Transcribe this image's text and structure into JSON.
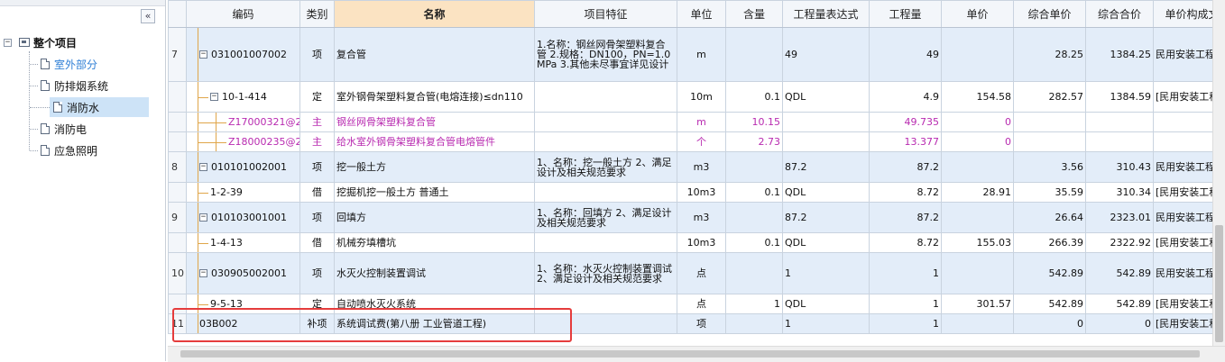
{
  "sidebar": {
    "collapse_label": "«",
    "root": {
      "toggle": "−",
      "label": "整个项目"
    },
    "items": [
      {
        "label": "室外部分",
        "selected": false,
        "link": true
      },
      {
        "label": "防排烟系统",
        "selected": false,
        "link": false
      },
      {
        "label": "消防水",
        "selected": true,
        "link": false
      },
      {
        "label": "消防电",
        "selected": false,
        "link": false
      },
      {
        "label": "应急照明",
        "selected": false,
        "link": false
      }
    ]
  },
  "table": {
    "headers": {
      "code": "编码",
      "category": "类别",
      "name": "名称",
      "feature": "项目特征",
      "unit": "单位",
      "content": "含量",
      "expr_header": "工程量表达式",
      "quantity": "工程量",
      "unit_price": "单价",
      "comp_unit_price": "综合单价",
      "comp_total": "综合合价",
      "price_struct": "单价构成文"
    },
    "rows": [
      {
        "no": "7",
        "level": 0,
        "toggle": "−",
        "code": "031001007002",
        "category": "项",
        "name": "复合管",
        "feature": "1.名称：钢丝网骨架塑料复合管\n2.规格：DN100，PN=1.0MPa\n3.其他未尽事宜详见设计",
        "unit": "m",
        "content": "",
        "expr": "49",
        "quantity": "49",
        "unit_price": "",
        "comp_unit_price": "28.25",
        "comp_total": "1384.25",
        "price_struct": "民用安装工程"
      },
      {
        "no": "",
        "level": 1,
        "toggle": "−",
        "code": "10-1-414",
        "category": "定",
        "name": "室外钢骨架塑料复合管(电熔连接)≤dn110",
        "feature": "",
        "unit": "10m",
        "content": "0.1",
        "expr": "QDL",
        "quantity": "4.9",
        "unit_price": "154.58",
        "comp_unit_price": "282.57",
        "comp_total": "1384.59",
        "price_struct": "[民用安装工程"
      },
      {
        "no": "",
        "level": 2,
        "toggle": "",
        "code": "Z17000321@2",
        "category": "主",
        "name": "钢丝网骨架塑料复合管",
        "feature": "",
        "unit": "m",
        "content": "10.15",
        "expr": "",
        "quantity": "49.735",
        "unit_price": "0",
        "comp_unit_price": "",
        "comp_total": "",
        "price_struct": ""
      },
      {
        "no": "",
        "level": 2,
        "toggle": "",
        "code": "Z18000235@2",
        "category": "主",
        "name": "给水室外钢骨架塑料复合管电熔管件",
        "feature": "",
        "unit": "个",
        "content": "2.73",
        "expr": "",
        "quantity": "13.377",
        "unit_price": "0",
        "comp_unit_price": "",
        "comp_total": "",
        "price_struct": ""
      },
      {
        "no": "8",
        "level": 0,
        "toggle": "−",
        "code": "010101002001",
        "category": "项",
        "name": "挖一般土方",
        "feature": "1、名称：挖一般土方\n2、满足设计及相关规范要求",
        "unit": "m3",
        "content": "",
        "expr": "87.2",
        "quantity": "87.2",
        "unit_price": "",
        "comp_unit_price": "3.56",
        "comp_total": "310.43",
        "price_struct": "民用安装工程"
      },
      {
        "no": "",
        "level": 1,
        "toggle": "",
        "code": "1-2-39",
        "category": "借",
        "name": "挖掘机挖一般土方 普通土",
        "feature": "",
        "unit": "10m3",
        "content": "0.1",
        "expr": "QDL",
        "quantity": "8.72",
        "unit_price": "28.91",
        "comp_unit_price": "35.59",
        "comp_total": "310.34",
        "price_struct": "[民用安装工程"
      },
      {
        "no": "9",
        "level": 0,
        "toggle": "−",
        "code": "010103001001",
        "category": "项",
        "name": "回填方",
        "feature": "1、名称：回填方\n2、满足设计及相关规范要求",
        "unit": "m3",
        "content": "",
        "expr": "87.2",
        "quantity": "87.2",
        "unit_price": "",
        "comp_unit_price": "26.64",
        "comp_total": "2323.01",
        "price_struct": "民用安装工程"
      },
      {
        "no": "",
        "level": 1,
        "toggle": "",
        "code": "1-4-13",
        "category": "借",
        "name": "机械夯填槽坑",
        "feature": "",
        "unit": "10m3",
        "content": "0.1",
        "expr": "QDL",
        "quantity": "8.72",
        "unit_price": "155.03",
        "comp_unit_price": "266.39",
        "comp_total": "2322.92",
        "price_struct": "[民用安装工程"
      },
      {
        "no": "10",
        "level": 0,
        "toggle": "−",
        "code": "030905002001",
        "category": "项",
        "name": "水灭火控制装置调试",
        "feature": "1、名称：水灭火控制装置调试\n2、满足设计及相关规范要求",
        "unit": "点",
        "content": "",
        "expr": "1",
        "quantity": "1",
        "unit_price": "",
        "comp_unit_price": "542.89",
        "comp_total": "542.89",
        "price_struct": "民用安装工程"
      },
      {
        "no": "",
        "level": 1,
        "toggle": "",
        "code": "9-5-13",
        "category": "定",
        "name": "自动喷水灭火系统",
        "feature": "",
        "unit": "点",
        "content": "1",
        "expr": "QDL",
        "quantity": "1",
        "unit_price": "301.57",
        "comp_unit_price": "542.89",
        "comp_total": "542.89",
        "price_struct": "[民用安装工程"
      },
      {
        "no": "11",
        "level": 0,
        "toggle": "",
        "code": "03B002",
        "category": "补项",
        "name": "系统调试费(第八册 工业管道工程)",
        "feature": "",
        "unit": "项",
        "content": "",
        "expr": "1",
        "quantity": "1",
        "unit_price": "",
        "comp_unit_price": "0",
        "comp_total": "0",
        "price_struct": "[民用安装工程"
      }
    ]
  },
  "colors": {
    "selected_header": "#fbe3c2",
    "bill_row": "#e3edf9",
    "material_text": "#b82ab0",
    "tree_line": "#e0a64a",
    "annotation": "#e53c3c"
  }
}
